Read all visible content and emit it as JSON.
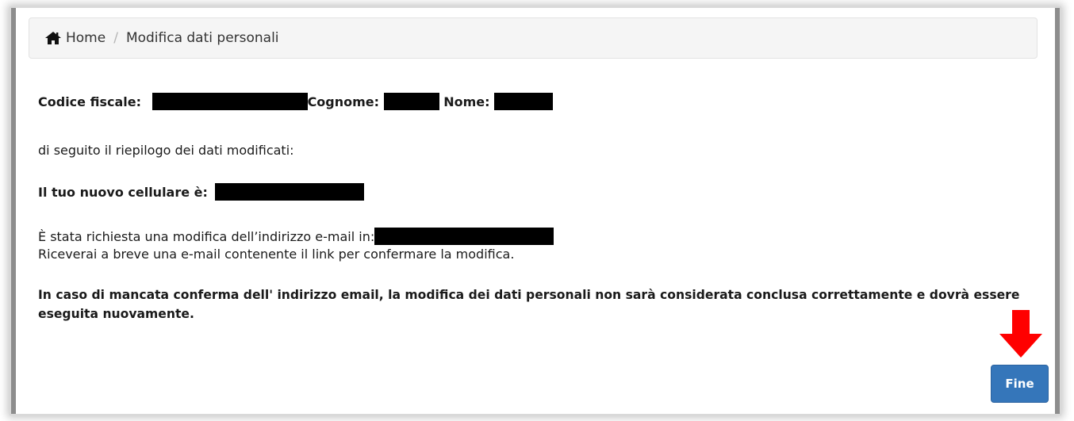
{
  "breadcrumb": {
    "home_label": "Home",
    "separator": "/",
    "current": "Modifica dati personali"
  },
  "identity": {
    "codice_fiscale_label": "Codice fiscale:",
    "cognome_label": "Cognome:",
    "nome_label": "Nome:"
  },
  "summary": {
    "intro": "di seguito il riepilogo dei dati modificati:",
    "cellulare_label": "Il tuo nuovo cellulare è:",
    "email_request": "È stata richiesta una modifica dell’indirizzo e-mail in:",
    "email_info": "Riceverai a breve una e-mail contenente il link per confermare la modifica.",
    "warning_line1": "In caso di mancata conferma dell' indirizzo email, la modifica dei dati personali non sarà considerata conclusa correttamente e dovrà essere",
    "warning_line2": "eseguita nuovamente."
  },
  "actions": {
    "fine_label": "Fine"
  },
  "colors": {
    "button": "#3576ba",
    "arrow": "#ff0000",
    "redaction": "#000000"
  },
  "icons": {
    "home": "home-icon",
    "arrow": "arrow-down-icon"
  }
}
